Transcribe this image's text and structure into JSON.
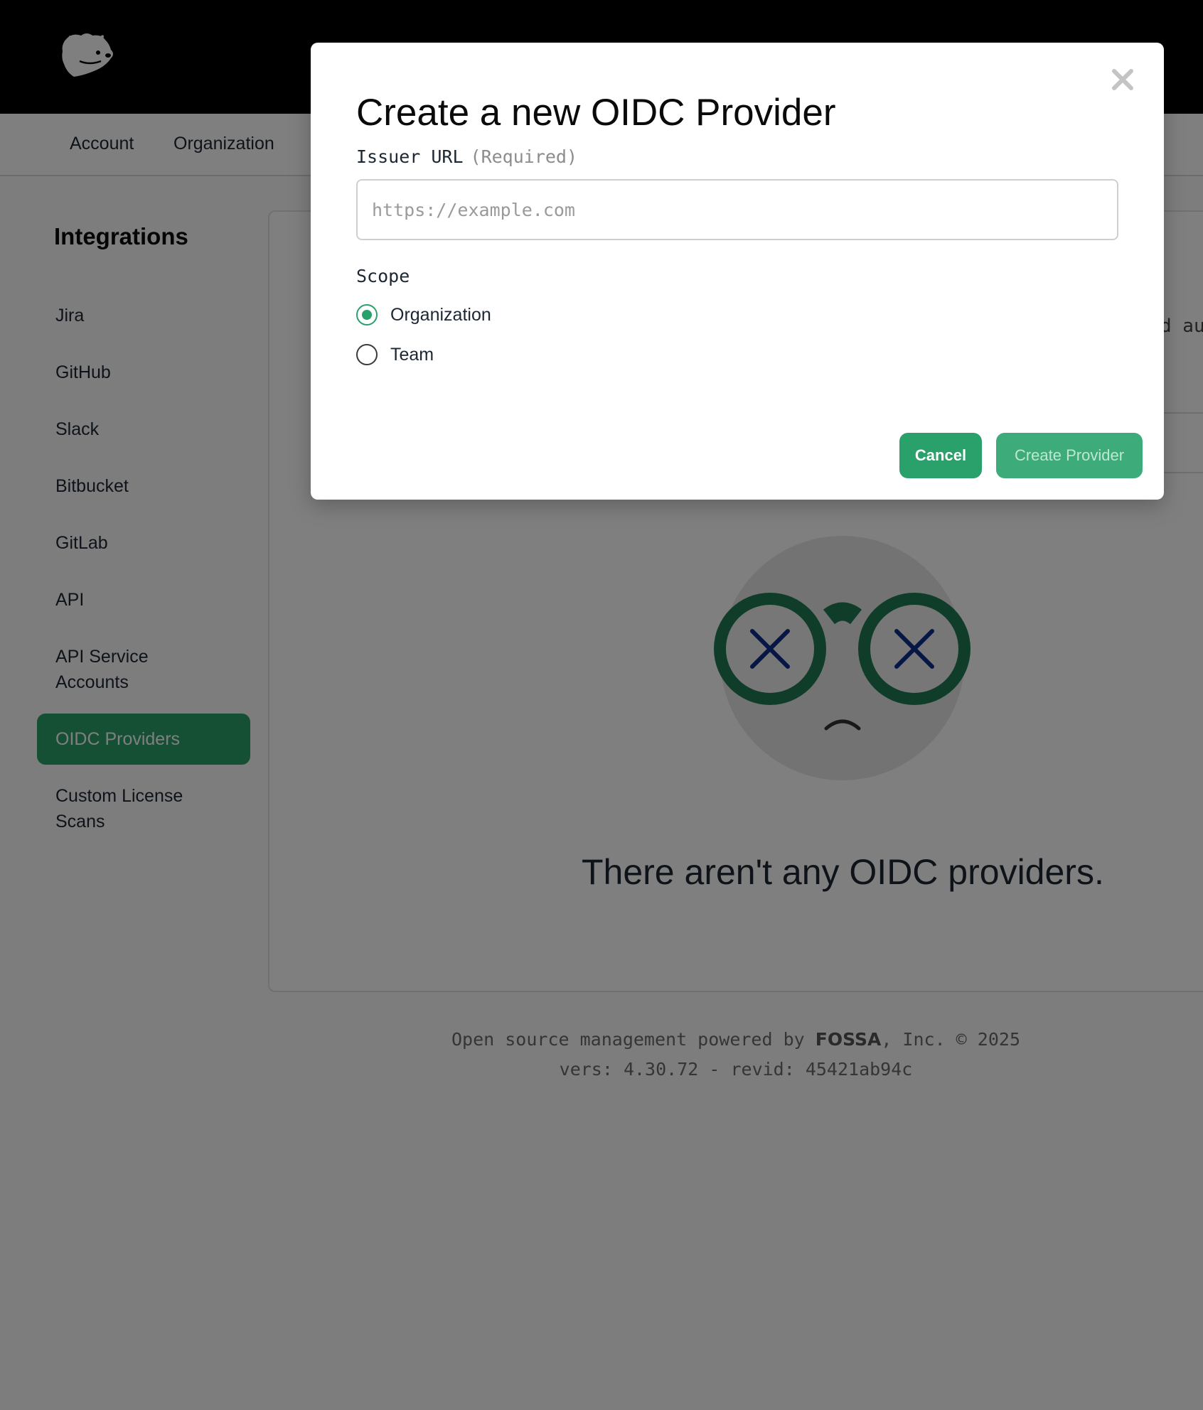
{
  "header": {
    "logo_icon": "bear-logo-icon"
  },
  "nav": {
    "tabs": [
      {
        "label": "Account"
      },
      {
        "label": "Organization"
      }
    ]
  },
  "sidebar": {
    "title": "Integrations",
    "items": [
      {
        "label": "Jira"
      },
      {
        "label": "GitHub"
      },
      {
        "label": "Slack"
      },
      {
        "label": "Bitbucket"
      },
      {
        "label": "GitLab"
      },
      {
        "label": "API"
      },
      {
        "label": "API Service Accounts"
      },
      {
        "label": "OIDC Providers",
        "active": true
      },
      {
        "label": "Custom License Scans"
      }
    ]
  },
  "main": {
    "partial_text": "d au",
    "empty_state_text": "There aren't any OIDC providers."
  },
  "footer": {
    "line1_prefix": "Open source management powered by ",
    "line1_brand": "FOSSA",
    "line1_suffix": ", Inc. © 2025",
    "line2": "vers: 4.30.72 - revid: 45421ab94c"
  },
  "modal": {
    "title": "Create a new OIDC Provider",
    "close_icon": "close-icon",
    "issuer_url": {
      "label": "Issuer URL",
      "required_note": "(Required)",
      "placeholder": "https://example.com",
      "value": ""
    },
    "scope": {
      "label": "Scope",
      "options": [
        {
          "label": "Organization",
          "selected": true
        },
        {
          "label": "Team",
          "selected": false
        }
      ]
    },
    "cancel_label": "Cancel",
    "create_label": "Create Provider"
  },
  "colors": {
    "accent": "#2aa06b",
    "header_bg": "#000000",
    "overlay": "rgba(0,0,0,0.5)"
  }
}
